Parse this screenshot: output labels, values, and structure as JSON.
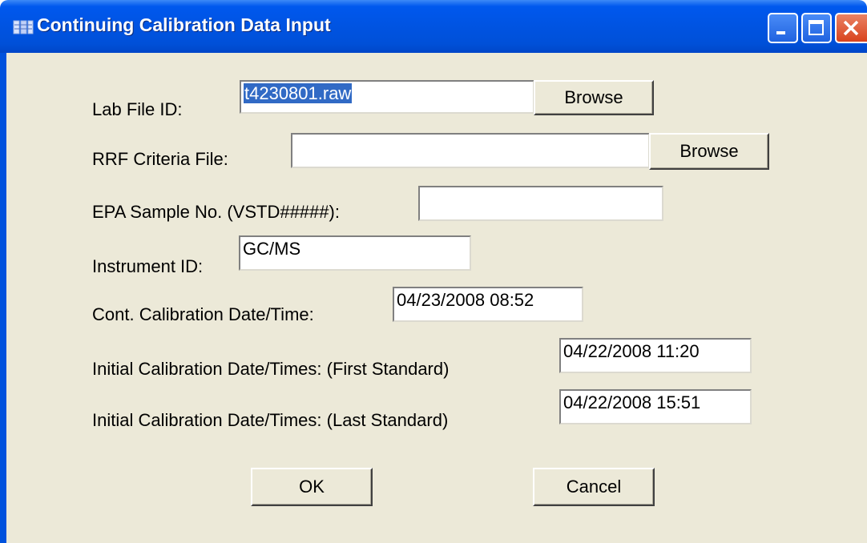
{
  "window": {
    "title": "Continuing Calibration Data Input",
    "titlebar_color": "#0054e3",
    "background_color": "#ece9d8"
  },
  "titlebar_buttons": {
    "minimize_icon": "minimize-icon",
    "maximize_icon": "maximize-icon",
    "close_icon": "close-icon"
  },
  "form": {
    "lab_file_id": {
      "label": "Lab File ID:",
      "value": "t4230801.raw",
      "browse_label": "Browse"
    },
    "rrf_criteria_file": {
      "label": "RRF Criteria File:",
      "value": "",
      "browse_label": "Browse"
    },
    "epa_sample_no": {
      "label": "EPA Sample No. (VSTD#####):",
      "value": ""
    },
    "instrument_id": {
      "label": "Instrument ID:",
      "value": "GC/MS"
    },
    "cont_calibration": {
      "label": "Cont. Calibration Date/Time:",
      "value": "04/23/2008 08:52"
    },
    "initial_first": {
      "label": "Initial Calibration Date/Times:  (First Standard)",
      "value": "04/22/2008 11:20"
    },
    "initial_last": {
      "label": "Initial Calibration Date/Times:  (Last Standard)",
      "value": "04/22/2008 15:51"
    }
  },
  "actions": {
    "ok_label": "OK",
    "cancel_label": "Cancel"
  }
}
